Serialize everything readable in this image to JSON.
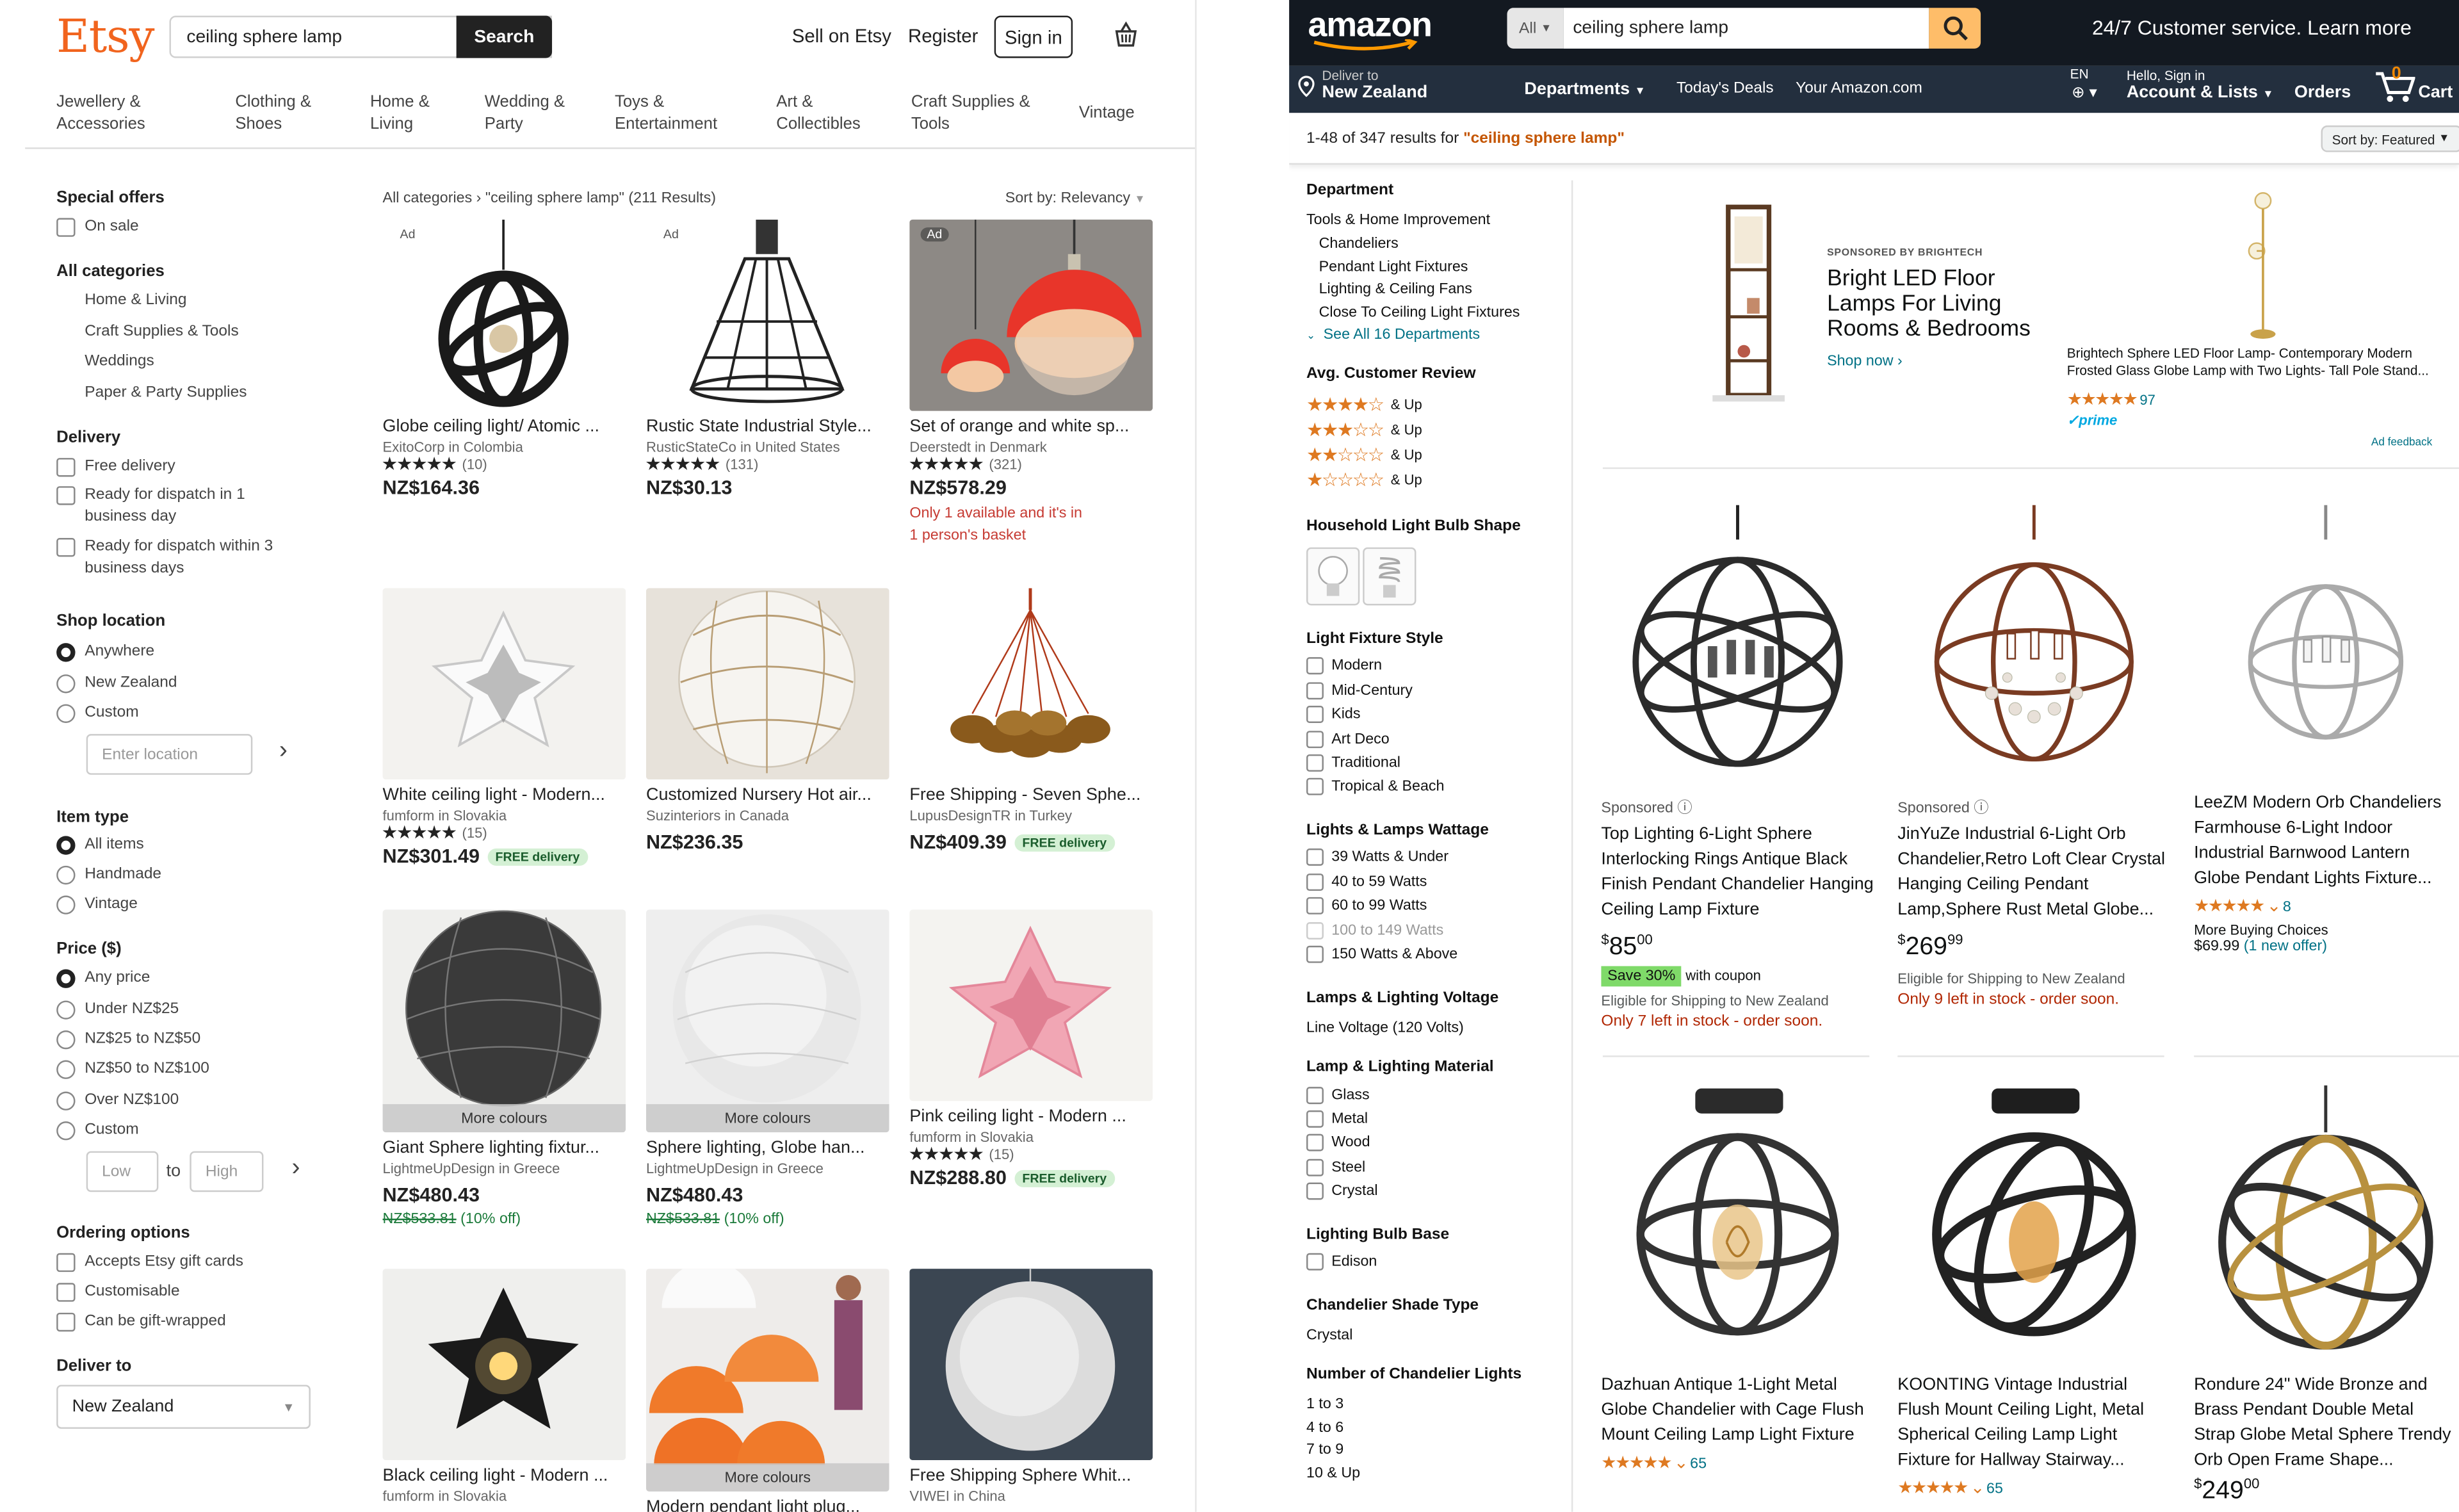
{
  "etsy": {
    "logo": "Etsy",
    "search_value": "ceiling sphere lamp",
    "search_button": "Search",
    "sell_link": "Sell on Etsy",
    "register_link": "Register",
    "signin_button": "Sign in",
    "nav": [
      "Jewellery &\nAccessories",
      "Clothing &\nShoes",
      "Home &\nLiving",
      "Wedding &\nParty",
      "Toys &\nEntertainment",
      "Art &\nCollectibles",
      "Craft Supplies &\nTools",
      "Vintage"
    ],
    "breadcrumb": "All categories › \"ceiling sphere lamp\" (211 Results)",
    "sort": "Sort by: Relevancy",
    "filters": {
      "special_offers": "Special offers",
      "on_sale": "On sale",
      "all_categories": "All categories",
      "categories": [
        "Home & Living",
        "Craft Supplies & Tools",
        "Weddings",
        "Paper & Party Supplies"
      ],
      "delivery": "Delivery",
      "delivery_opts": [
        "Free delivery",
        "Ready for dispatch in 1\nbusiness day",
        "Ready for dispatch within 3\nbusiness days"
      ],
      "shop_location": "Shop location",
      "location_opts": [
        "Anywhere",
        "New Zealand",
        "Custom"
      ],
      "location_placeholder": "Enter location",
      "item_type": "Item type",
      "item_opts": [
        "All items",
        "Handmade",
        "Vintage"
      ],
      "price": "Price ($)",
      "price_opts": [
        "Any price",
        "Under NZ$25",
        "NZ$25 to NZ$50",
        "NZ$50 to NZ$100",
        "Over NZ$100",
        "Custom"
      ],
      "low": "Low",
      "to": "to",
      "high": "High",
      "ordering": "Ordering options",
      "ordering_opts": [
        "Accepts Etsy gift cards",
        "Customisable",
        "Can be gift-wrapped"
      ],
      "deliver_to": "Deliver to",
      "deliver_value": "New Zealand"
    },
    "listings": [
      {
        "title": "Globe ceiling light/ Atomic ...",
        "shop": "ExitoCorp in Colombia",
        "stars": "★★★★★",
        "reviews": "(10)",
        "price": "NZ$164.36",
        "ad": "Ad"
      },
      {
        "title": "Rustic State Industrial Style...",
        "shop": "RusticStateCo in United States",
        "stars": "★★★★★",
        "reviews": "(131)",
        "price": "NZ$30.13",
        "ad": "Ad"
      },
      {
        "title": "Set of orange and white sp...",
        "shop": "Deerstedt in Denmark",
        "stars": "★★★★★",
        "reviews": "(321)",
        "price": "NZ$578.29",
        "ad": "Ad",
        "warn": "Only 1 available and it's in\n1 person's basket"
      },
      {
        "title": "White ceiling light - Modern...",
        "shop": "fumform in Slovakia",
        "stars": "★★★★★",
        "reviews": "(15)",
        "price": "NZ$301.49",
        "free": "FREE delivery"
      },
      {
        "title": "Customized Nursery Hot air...",
        "shop": "Suzinteriors in Canada",
        "price": "NZ$236.35"
      },
      {
        "title": "Free Shipping - Seven Sphe...",
        "shop": "LupusDesignTR in Turkey",
        "price": "NZ$409.39",
        "free": "FREE delivery"
      },
      {
        "title": "Giant Sphere lighting fixtur...",
        "shop": "LightmeUpDesign in Greece",
        "price": "NZ$480.43",
        "old": "NZ$533.81",
        "off": "(10% off)",
        "more": "More colours"
      },
      {
        "title": "Sphere lighting, Globe han...",
        "shop": "LightmeUpDesign in Greece",
        "price": "NZ$480.43",
        "old": "NZ$533.81",
        "off": "(10% off)",
        "more": "More colours"
      },
      {
        "title": "Pink ceiling light - Modern ...",
        "shop": "fumform in Slovakia",
        "stars": "★★★★★",
        "reviews": "(15)",
        "price": "NZ$288.80",
        "free": "FREE delivery"
      },
      {
        "title": "Black ceiling light - Modern ...",
        "shop": "fumform in Slovakia"
      },
      {
        "title": "Modern pendant light plug...",
        "more": "More colours"
      },
      {
        "title": "Free Shipping Sphere Whit...",
        "shop": "VIWEI in China"
      }
    ]
  },
  "amazon": {
    "logo": "amazon",
    "all": "All",
    "search_value": "ceiling sphere lamp",
    "customer_service": "24/7 Customer service. Learn more",
    "deliver_line1": "Deliver to",
    "deliver_line2": "New Zealand",
    "departments": "Departments",
    "todays_deals": "Today's Deals",
    "your_amazon": "Your Amazon.com",
    "lang": "EN",
    "hello": "Hello, Sign in",
    "account": "Account & Lists",
    "orders": "Orders",
    "cart_count": "0",
    "cart": "Cart",
    "results_prefix": "1-48 of 347 results for ",
    "results_query": "\"ceiling sphere lamp\"",
    "sort": "Sort by: Featured",
    "sidebar": {
      "department": "Department",
      "dept_items": [
        "Tools & Home Improvement",
        "Chandeliers",
        "Pendant Light Fixtures",
        "Lighting & Ceiling Fans",
        "Close To Ceiling Light Fixtures"
      ],
      "see_all": "See All 16 Departments",
      "avg_review": "Avg. Customer Review",
      "and_up": "& Up",
      "bulb_shape": "Household Light Bulb Shape",
      "fixture_style": "Light Fixture Style",
      "fixture_opts": [
        "Modern",
        "Mid-Century",
        "Kids",
        "Art Deco",
        "Traditional",
        "Tropical & Beach"
      ],
      "wattage": "Lights & Lamps Wattage",
      "wattage_opts": [
        "39 Watts & Under",
        "40 to 59 Watts",
        "60 to 99 Watts",
        "100 to 149 Watts",
        "150 Watts & Above"
      ],
      "voltage": "Lamps & Lighting Voltage",
      "voltage_val": "Line Voltage (120 Volts)",
      "material": "Lamp & Lighting Material",
      "material_opts": [
        "Glass",
        "Metal",
        "Wood",
        "Steel",
        "Crystal"
      ],
      "base": "Lighting Bulb Base",
      "base_opts": [
        "Edison"
      ],
      "shade": "Chandelier Shade Type",
      "shade_val": "Crystal",
      "num_lights": "Number of Chandelier Lights",
      "num_opts": [
        "1 to 3",
        "4 to 6",
        "7 to 9",
        "10 & Up"
      ]
    },
    "ad": {
      "sponsored": "SPONSORED BY BRIGHTECH",
      "headline": "Bright LED Floor\nLamps For Living\nRooms & Bedrooms",
      "shop_now": "Shop now ›",
      "product": "Brightech Sphere LED Floor Lamp- Contemporary Modern Frosted Glass Globe Lamp with Two Lights- Tall Pole Stand...",
      "rating": "★★★★★",
      "reviews": "97",
      "prime": "✓prime",
      "feedback": "Ad feedback"
    },
    "products": [
      {
        "sponsored": "Sponsored ⓘ",
        "title": "Top Lighting 6-Light Sphere Interlocking Rings Antique Black Finish Pendant Chandelier Hanging Ceiling Lamp Fixture",
        "price_whole": "85",
        "price_frac": "00",
        "save": "Save 30%",
        "coupon": "with coupon",
        "ship": "Eligible for Shipping to New Zealand",
        "stock": "Only 7 left in stock - order soon."
      },
      {
        "sponsored": "Sponsored ⓘ",
        "title": "JinYuZe Industrial 6-Light Orb Chandelier,Retro Loft Clear Crystal Hanging Ceiling Pendant Lamp,Sphere Rust Metal Globe...",
        "price_whole": "269",
        "price_frac": "99",
        "ship": "Eligible for Shipping to New Zealand",
        "stock": "Only 9 left in stock - order soon."
      },
      {
        "title": "LeeZM Modern Orb Chandeliers Farmhouse 6-Light Indoor Industrial Barnwood Lantern Globe Pendant Lights Fixture...",
        "stars": "★★★★★",
        "reviews": "8",
        "buying": "More Buying Choices",
        "buying_price": "$69.99",
        "buying_offer": "(1 new offer)"
      },
      {
        "title": "Dazhuan Antique 1-Light Metal Globe Chandelier with Cage Flush Mount Ceiling Lamp Light Fixture",
        "stars": "★★★★★",
        "reviews": "65"
      },
      {
        "title": "KOONTING Vintage Industrial Flush Mount Ceiling Light, Metal Spherical Ceiling Lamp Light Fixture for Hallway Stairway...",
        "stars": "★★★★★",
        "reviews": "65"
      },
      {
        "title": "Rondure 24\" Wide Bronze and Brass Pendant Double Metal Strap Globe Metal Sphere Trendy Orb Open Frame Shape...",
        "price_whole": "249",
        "price_frac": "00"
      }
    ]
  },
  "colors": {
    "etsy_orange": "#f1641e",
    "amazon_dark": "#131921",
    "amazon_orange": "#febd69",
    "star_orange": "#de7921"
  }
}
